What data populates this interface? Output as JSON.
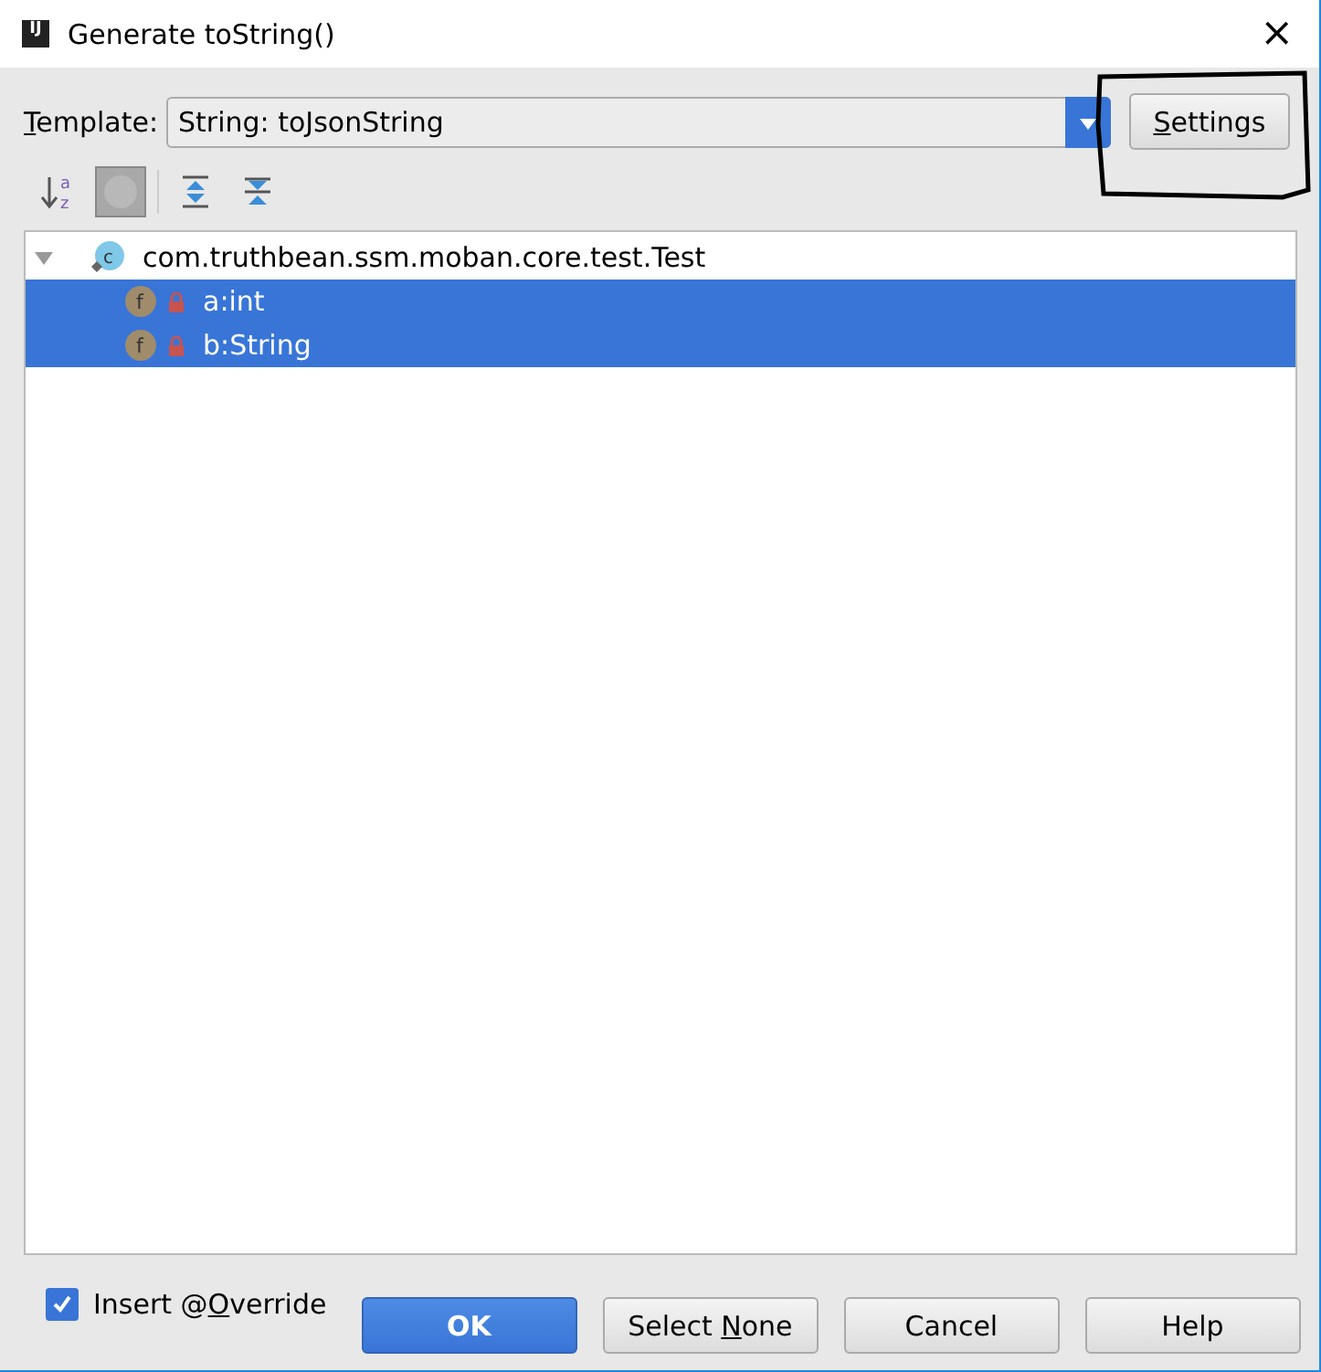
{
  "window": {
    "icon": "IJ",
    "title": "Generate toString()",
    "close": "×"
  },
  "template": {
    "label": {
      "key": "T",
      "after": "emplate:"
    },
    "value": "String: toJsonString",
    "settings": {
      "key": "S",
      "after": "ettings"
    }
  },
  "toolbar": [
    {
      "kind": "sort",
      "letters": [
        "a",
        "z"
      ],
      "selected": false
    },
    {
      "kind": "circle",
      "selected": true
    },
    {
      "kind": "expand",
      "selected": false
    },
    {
      "kind": "collapse",
      "selected": false
    }
  ],
  "tree": [
    {
      "label": "com.truthbean.ssm.moban.core.test.Test",
      "kind": "class",
      "badge": "c",
      "expanded": true,
      "selected": false,
      "children": [
        {
          "label": "a:int",
          "kind": "field",
          "badge": "f",
          "selected": true
        },
        {
          "label": "b:String",
          "kind": "field",
          "badge": "f",
          "selected": true
        }
      ]
    }
  ],
  "override": {
    "checked": true,
    "label": {
      "before": "Insert @",
      "key": "O",
      "after": "verride"
    }
  },
  "buttons": [
    {
      "label": {
        "before": "OK"
      },
      "kind": "primary"
    },
    {
      "label": {
        "before": "Select ",
        "key": "N",
        "after": "one"
      },
      "kind": "normal"
    },
    {
      "label": {
        "before": "Cancel"
      },
      "kind": "normal"
    },
    {
      "label": {
        "before": "Help"
      },
      "kind": "normal"
    }
  ]
}
